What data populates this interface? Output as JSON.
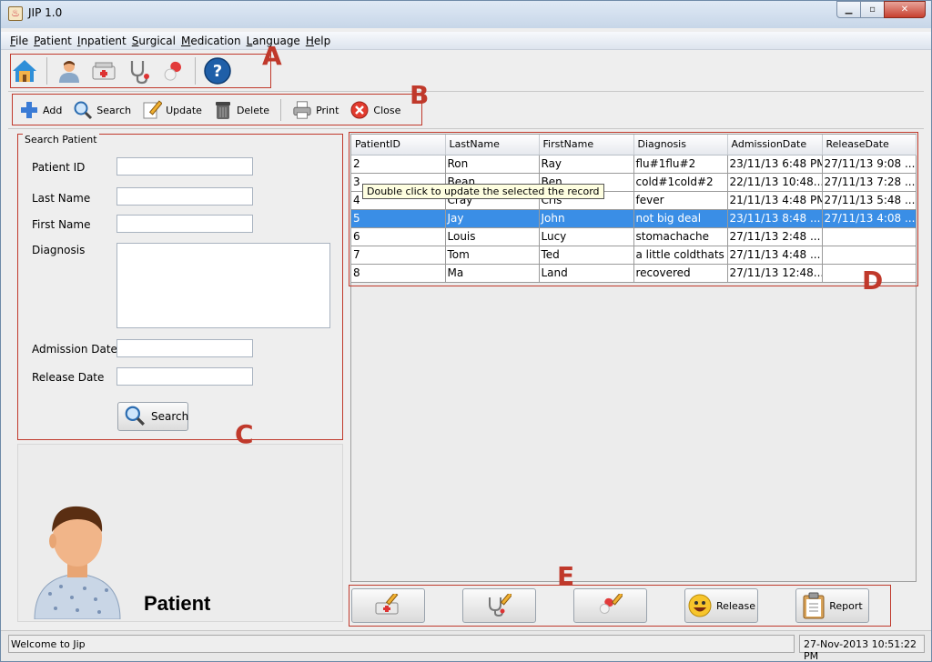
{
  "window": {
    "title": "JIP 1.0"
  },
  "menu": [
    "File",
    "Patient",
    "Inpatient",
    "Surgical",
    "Medication",
    "Language",
    "Help"
  ],
  "toolbar_a_icons": [
    "home-icon",
    "patient-icon",
    "inpatient-bed-icon",
    "stethoscope-icon",
    "medication-pill-icon",
    "help-icon"
  ],
  "actions": {
    "add": "Add",
    "search": "Search",
    "update": "Update",
    "delete": "Delete",
    "print": "Print",
    "close": "Close"
  },
  "labels": {
    "a": "A",
    "b": "B",
    "c": "C",
    "d": "D",
    "e": "E"
  },
  "search_panel": {
    "legend": "Search Patient",
    "patient_id": "Patient ID",
    "last_name": "Last Name",
    "first_name": "First Name",
    "diagnosis": "Diagnosis",
    "admission_date": "Admission Date",
    "release_date": "Release Date",
    "search_button": "Search"
  },
  "patient_card": {
    "label": "Patient"
  },
  "table": {
    "columns": [
      "PatientID",
      "LastName",
      "FirstName",
      "Diagnosis",
      "AdmissionDate",
      "ReleaseDate"
    ],
    "rows": [
      [
        "2",
        "Ron",
        "Ray",
        "flu#1flu#2",
        "23/11/13 6:48 PM",
        "27/11/13 9:08 ..."
      ],
      [
        "3",
        "Bean",
        "Ben",
        "cold#1cold#2",
        "22/11/13 10:48...",
        "27/11/13 7:28 ..."
      ],
      [
        "4",
        "Cray",
        "Cris",
        "fever",
        "21/11/13 4:48 PM",
        "27/11/13 5:48 ..."
      ],
      [
        "5",
        "Jay",
        "John",
        "not big deal",
        "23/11/13 8:48 ...",
        "27/11/13 4:08 ..."
      ],
      [
        "6",
        "Louis",
        "Lucy",
        "stomachache",
        "27/11/13 2:48 ...",
        ""
      ],
      [
        "7",
        "Tom",
        "Ted",
        "a little coldthats it",
        "27/11/13 4:48 ...",
        ""
      ],
      [
        "8",
        "Ma",
        "Land",
        "recovered",
        "27/11/13 12:48...",
        ""
      ]
    ],
    "selected_row": 3,
    "tooltip": "Double click to update the selected the record"
  },
  "bottom_buttons": {
    "release": "Release",
    "report": "Report"
  },
  "status": {
    "message": "Welcome to Jip",
    "datetime": "27-Nov-2013 10:51:22 PM"
  },
  "colors": {
    "annotation": "#c0392b",
    "selection": "#3a8ee6"
  }
}
